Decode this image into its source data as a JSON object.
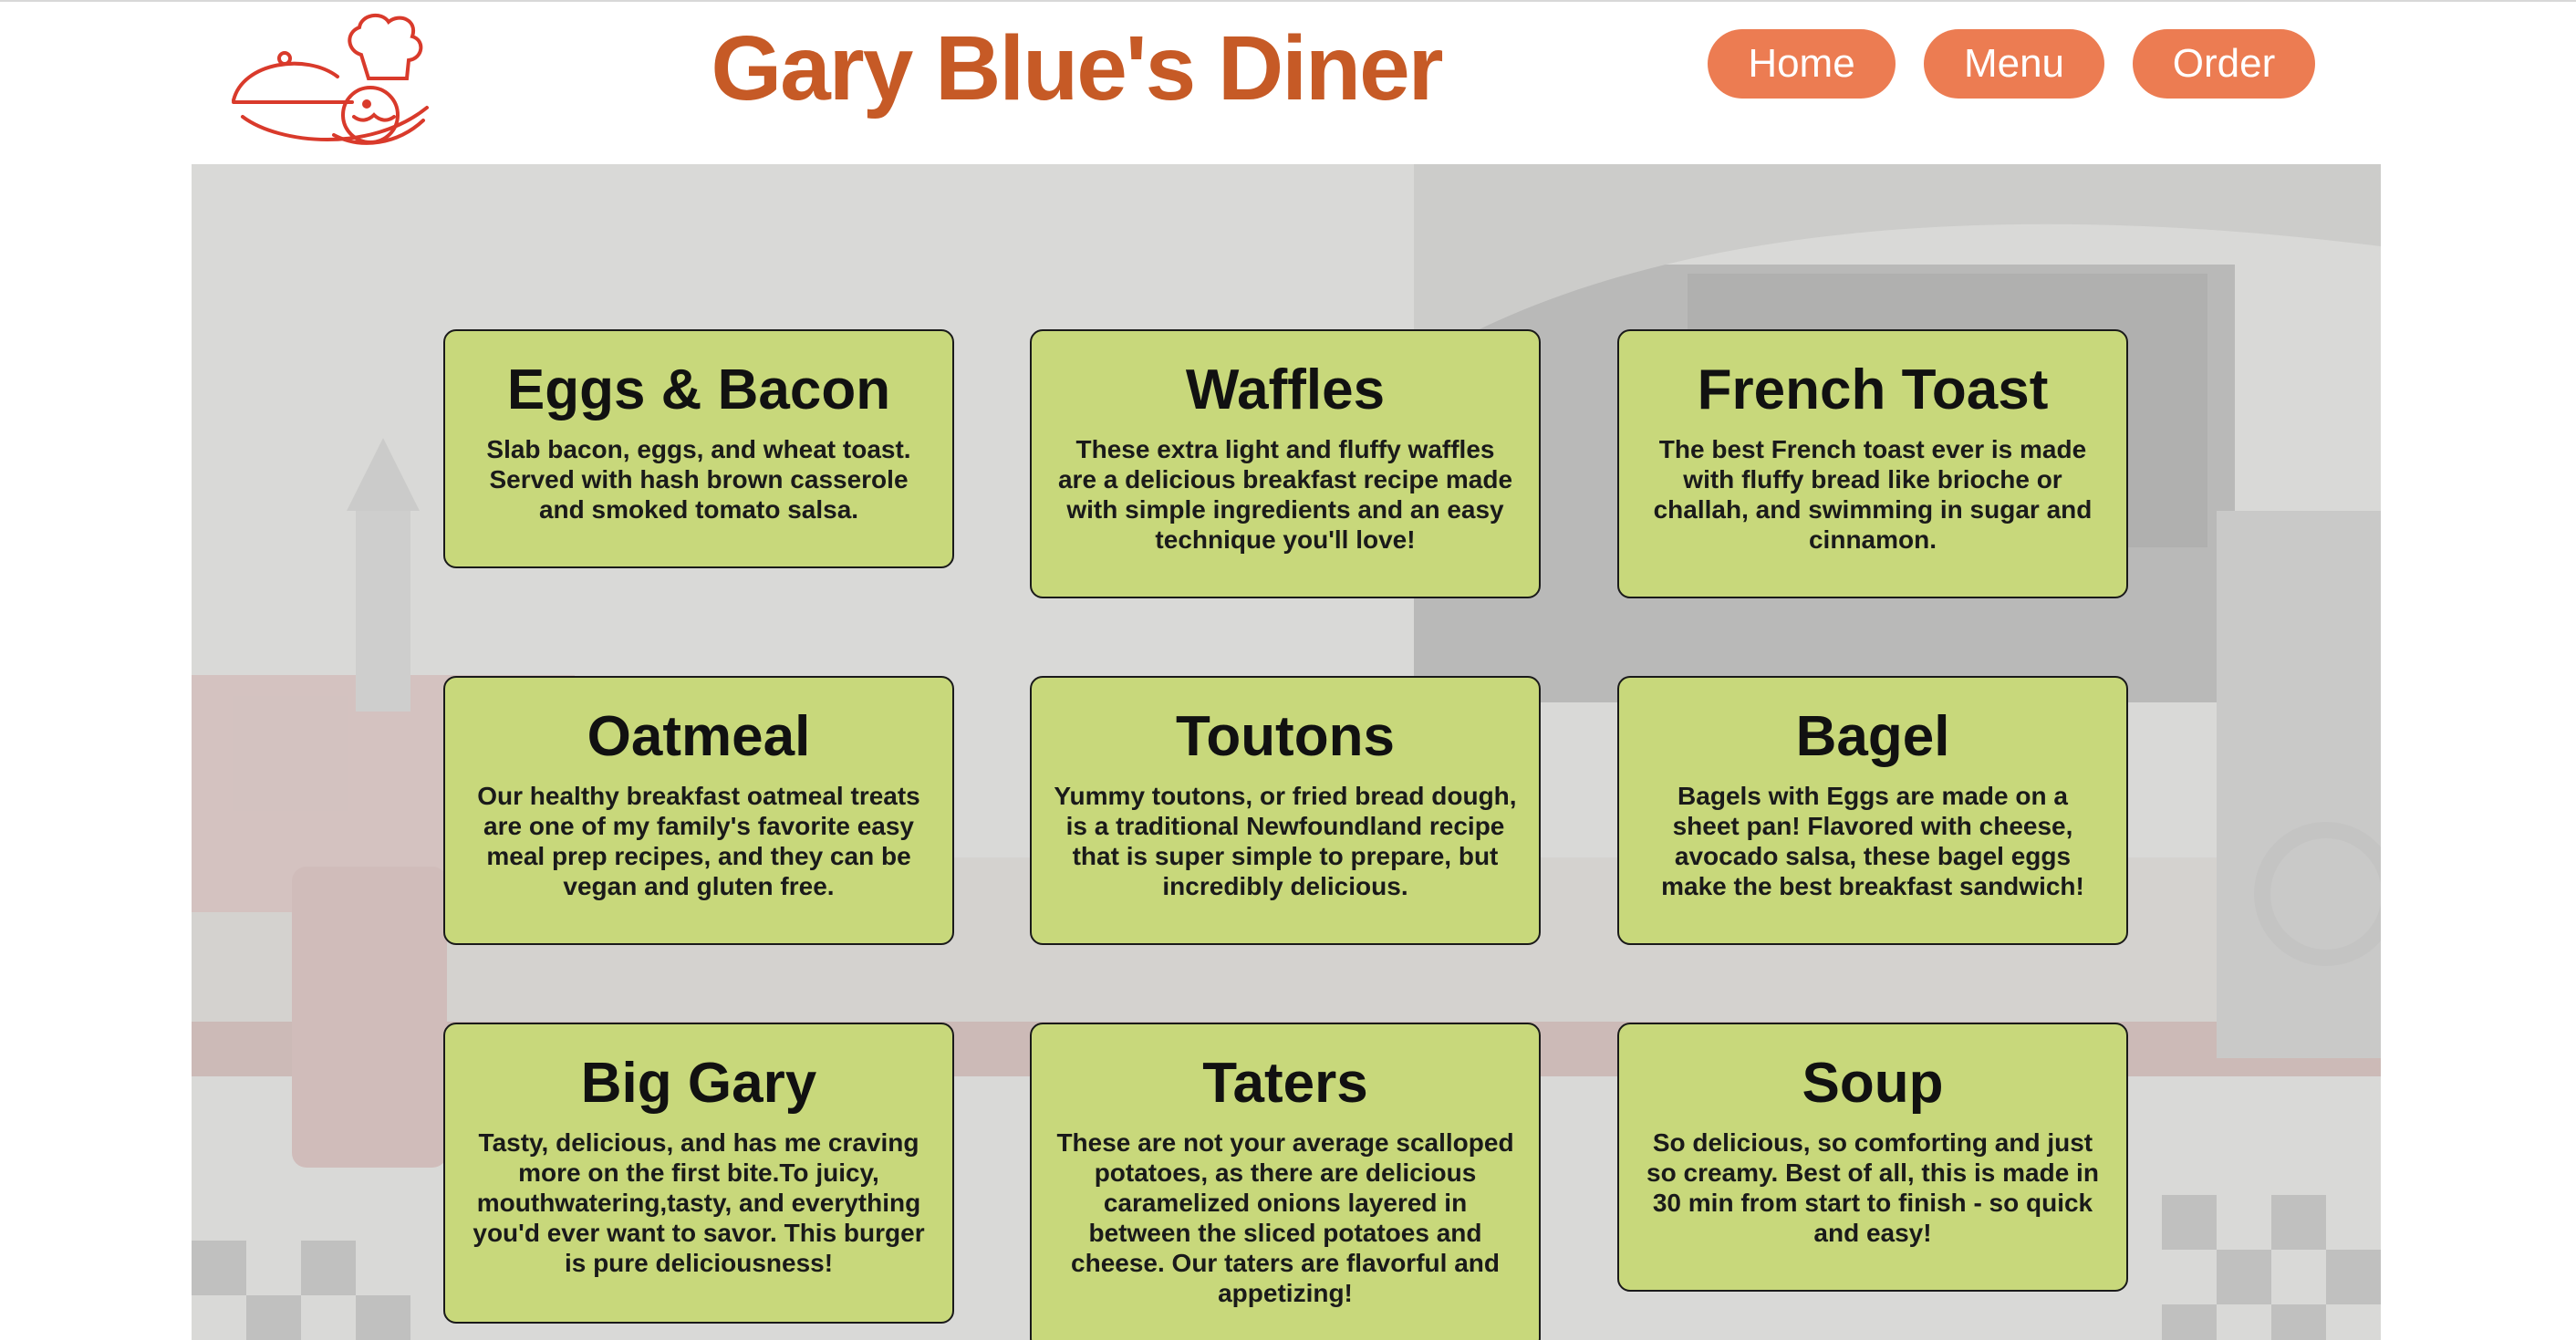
{
  "site": {
    "title": "Gary Blue's Diner",
    "logo_icon": "chef-cloche-icon",
    "accent_color": "#c65a26",
    "button_color": "#ec7c52",
    "card_color": "#c8d87b"
  },
  "nav": {
    "home": "Home",
    "menu": "Menu",
    "order": "Order"
  },
  "menu_items": [
    {
      "name": "Eggs & Bacon",
      "description": "Slab bacon, eggs, and wheat toast. Served with hash brown casserole and smoked tomato salsa."
    },
    {
      "name": "Waffles",
      "description": "These extra light and fluffy waffles are a delicious breakfast recipe made with simple ingredients and an easy technique you'll love!"
    },
    {
      "name": "French Toast",
      "description": "The best French toast ever is made with fluffy bread like brioche or challah, and swimming in sugar and cinnamon."
    },
    {
      "name": "Oatmeal",
      "description": "Our healthy breakfast oatmeal treats are one of my family's favorite easy meal prep recipes, and they can be vegan and gluten free."
    },
    {
      "name": "Toutons",
      "description": "Yummy toutons, or fried bread dough, is a traditional Newfoundland recipe that is super simple to prepare, but incredibly delicious."
    },
    {
      "name": "Bagel",
      "description": "Bagels with Eggs are made on a sheet pan! Flavored with cheese, avocado salsa, these bagel eggs make the best breakfast sandwich!"
    },
    {
      "name": "Big Gary",
      "description": "Tasty, delicious, and has me craving more on the first bite.To juicy, mouthwatering,tasty, and everything you'd ever want to savor. This burger is pure deliciousness!"
    },
    {
      "name": "Taters",
      "description": "These are not your average scalloped potatoes, as there are delicious caramelized onions layered in between the sliced potatoes and cheese. Our taters are flavorful and appetizing!"
    },
    {
      "name": "Soup",
      "description": "So delicious, so comforting and just so creamy. Best of all, this is made in 30 min from start to finish - so quick and easy!"
    }
  ]
}
